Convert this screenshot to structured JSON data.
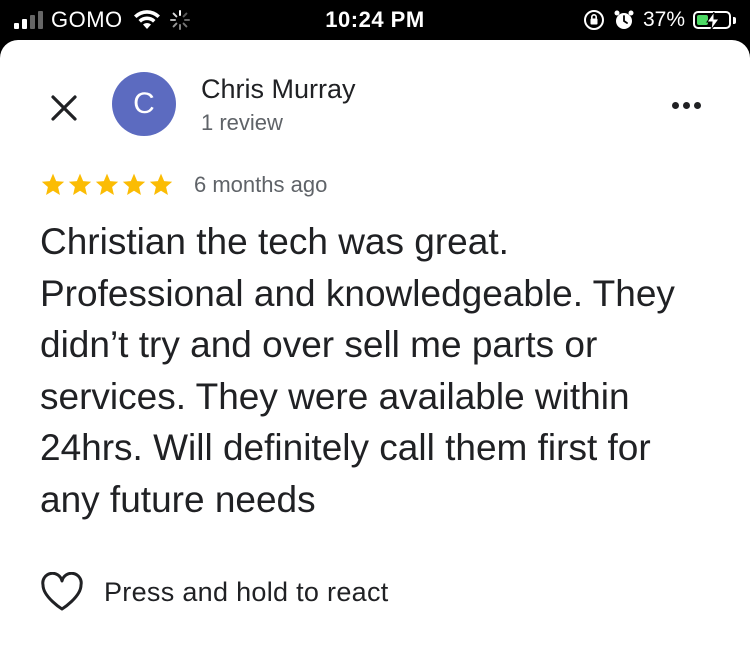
{
  "status_bar": {
    "carrier": "GOMO",
    "time": "10:24 PM",
    "battery_percent": "37%",
    "signal_bars_active": 2,
    "signal_bars_total": 4,
    "battery_level": 0.37,
    "battery_charging": true,
    "icons": [
      "wifi-icon",
      "loading-spinner-icon",
      "orientation-lock-icon",
      "alarm-icon",
      "battery-icon"
    ]
  },
  "review": {
    "author_name": "Chris Murray",
    "author_initial": "C",
    "review_count": "1 review",
    "rating": 5,
    "rating_max": 5,
    "time_ago": "6 months ago",
    "text": "Christian the tech was great. Professional and knowledgeable. They didn’t try and over sell me parts or services. They were available within 24hrs. Will definitely call them first for any future needs"
  },
  "actions": {
    "close_icon": "close-icon",
    "more_icon": "more-horizontal-icon",
    "react_icon": "heart-outline-icon",
    "react_label": "Press and hold to react"
  },
  "colors": {
    "avatar": "#5c6bc0",
    "star": "#fbbc04",
    "text_primary": "#202124",
    "text_secondary": "#5f6368",
    "battery_fill": "#4cd964"
  }
}
